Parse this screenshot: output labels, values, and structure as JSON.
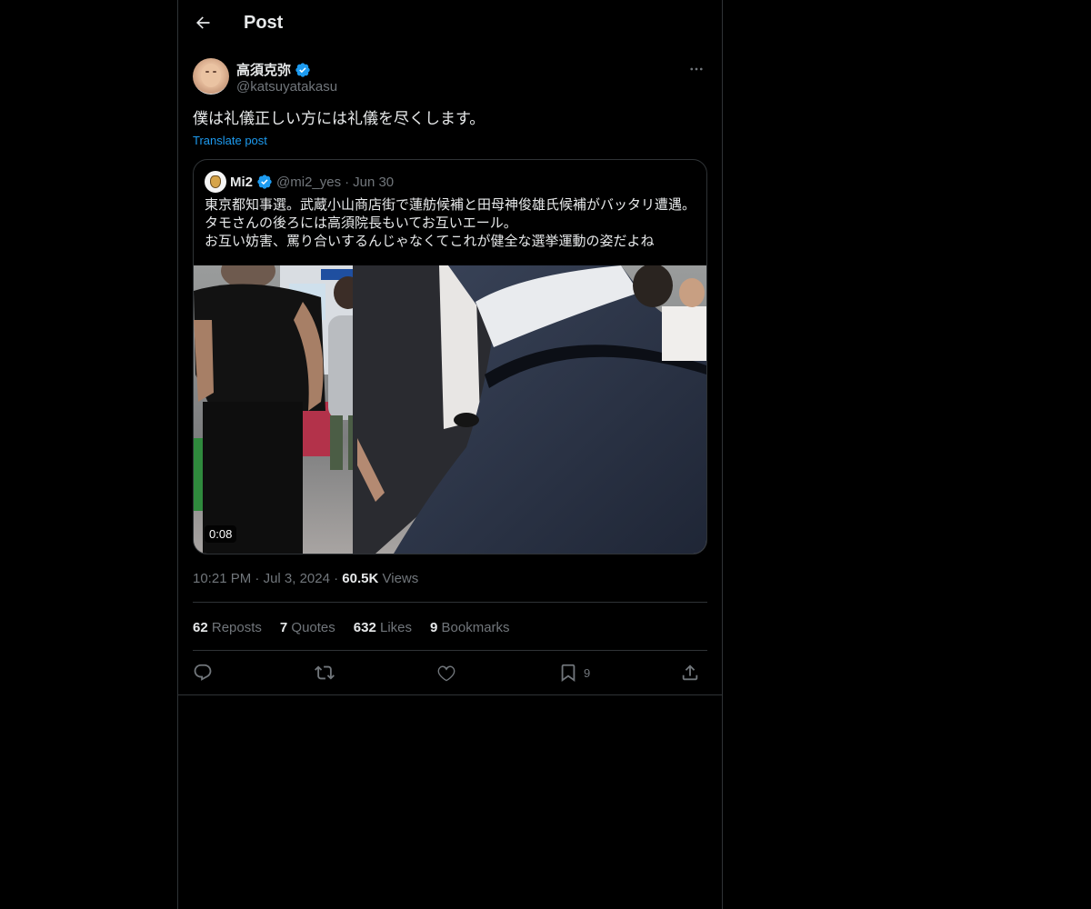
{
  "header": {
    "title": "Post",
    "back_icon": "arrow-left-icon"
  },
  "author": {
    "display_name": "高須克弥",
    "handle": "@katsuyatakasu",
    "verified": true,
    "more_icon": "more-horizontal-icon"
  },
  "tweet": {
    "text": "僕は礼儀正しい方には礼儀を尽くします。",
    "translate_label": "Translate post"
  },
  "quote": {
    "display_name": "Mi2",
    "handle": "@mi2_yes",
    "separator": "·",
    "date": "Jun 30",
    "lines": [
      "東京都知事選。武蔵小山商店街で蓮舫候補と田母神俊雄氏候補がバッタリ遭遇。",
      "タモさんの後ろには高須院長もいてお互いエール。",
      "お互い妨害、罵り合いするんじゃなくてこれが健全な選挙運動の姿だよね"
    ],
    "video_duration": "0:08"
  },
  "meta": {
    "time": "10:21 PM",
    "separator": "·",
    "date": "Jul 3, 2024",
    "views_count": "60.5K",
    "views_label": "Views"
  },
  "stats": [
    {
      "count": "62",
      "label": "Reposts"
    },
    {
      "count": "7",
      "label": "Quotes"
    },
    {
      "count": "632",
      "label": "Likes"
    },
    {
      "count": "9",
      "label": "Bookmarks"
    }
  ],
  "actions": {
    "reply_icon": "reply-icon",
    "repost_icon": "repost-icon",
    "like_icon": "heart-icon",
    "bookmark_icon": "bookmark-icon",
    "bookmark_count": "9",
    "share_icon": "share-icon"
  },
  "colors": {
    "background": "#000000",
    "text_primary": "#e7e9ea",
    "text_secondary": "#71767b",
    "accent": "#1d9bf0",
    "border": "#2f3336"
  }
}
